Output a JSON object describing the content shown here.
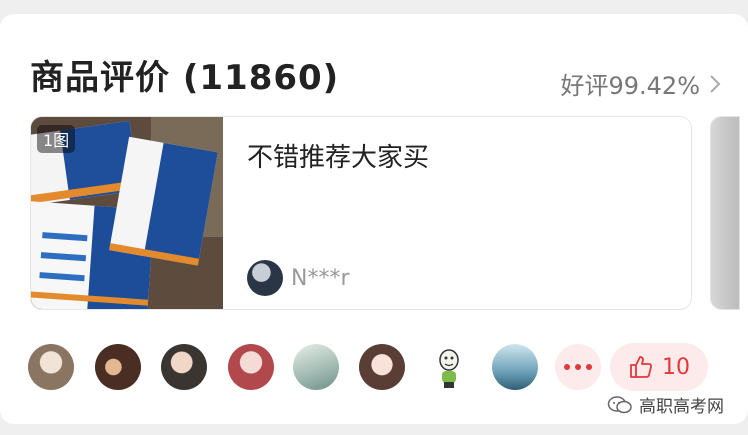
{
  "header": {
    "title": "商品评价 (11860)",
    "rating_label": "好评99.42%"
  },
  "review": {
    "image_badge": "1图",
    "text": "不错推荐大家买",
    "reviewer_name": "N***r"
  },
  "actions": {
    "like_count": "10"
  },
  "watermark": {
    "text": "高职高考网"
  },
  "colors": {
    "accent": "#e1393a",
    "accent_bg": "#fdeaea"
  }
}
